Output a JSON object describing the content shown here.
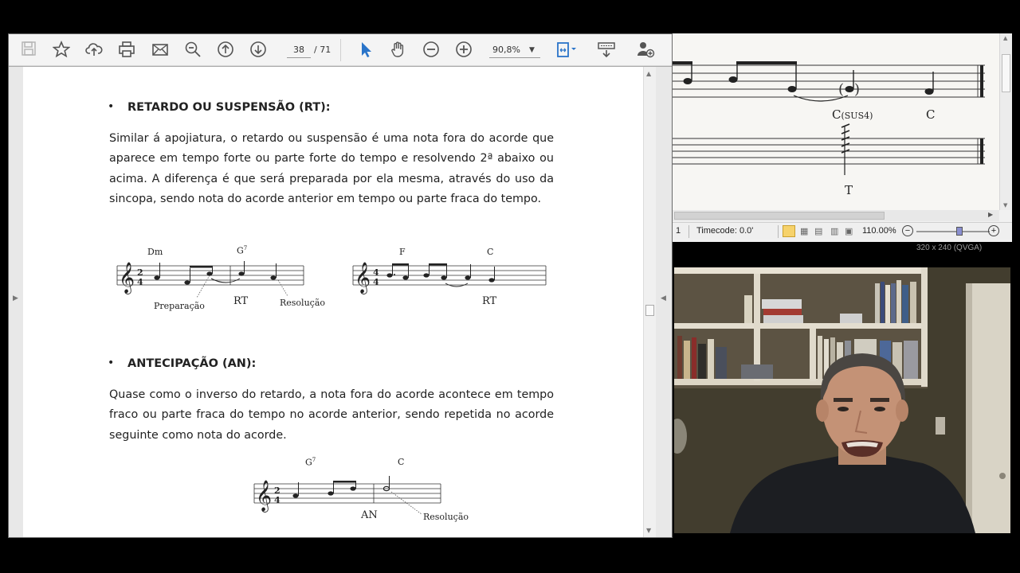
{
  "pdf_viewer": {
    "toolbar": {
      "page_current": "38",
      "page_total": "/ 71",
      "zoom_value": "90,8%",
      "icons": [
        "save-icon",
        "bookmark-star-icon",
        "cloud-upload-icon",
        "print-icon",
        "email-icon",
        "zoom-out-search-icon",
        "page-up-icon",
        "page-down-icon",
        "select-cursor-icon",
        "hand-tool-icon",
        "zoom-minus-icon",
        "zoom-plus-icon",
        "fit-page-icon",
        "read-mode-icon",
        "add-user-icon"
      ]
    },
    "document": {
      "section1": {
        "bullet": "•",
        "title": "RETARDO OU SUSPENSÃO (RT):",
        "paragraph": "Similar á apojiatura, o retardo ou suspensão é uma nota fora do acorde que aparece em tempo forte ou parte forte do tempo e resolvendo 2ª abaixo ou acima. A diferença é que será preparada por ela mesma, através do uso da sincopa, sendo nota do acorde anterior em tempo ou parte fraca do tempo.",
        "example1": {
          "chord1": "Dm",
          "chord2": "G",
          "chord2_sup": "7",
          "time_sig_top": "2",
          "time_sig_bottom": "4",
          "label_prep": "Preparação",
          "label_rt": "RT",
          "label_res": "Resolução"
        },
        "example2": {
          "chord1": "F",
          "chord2": "C",
          "time_sig_top": "4",
          "time_sig_bottom": "4",
          "label_rt": "RT"
        }
      },
      "section2": {
        "bullet": "•",
        "title": "ANTECIPAÇÃO (AN):",
        "paragraph": "Quase como o inverso do retardo, a nota fora do acorde acontece em tempo fraco ou parte fraca do tempo no acorde anterior, sendo repetida no acorde seguinte como nota do acorde.",
        "example": {
          "chord1": "G",
          "chord1_sup": "7",
          "chord2": "C",
          "time_sig_top": "2",
          "time_sig_bottom": "4",
          "label_an": "AN",
          "label_res": "Resolução"
        }
      }
    }
  },
  "notation_window": {
    "chord1": "C",
    "chord1_suffix": "(SUS4)",
    "chord2": "C",
    "tab_label": "T",
    "status": {
      "field1": "1",
      "timecode": "Timecode: 0.0'",
      "zoom": "110.00%"
    },
    "resolution_label": "320 x 240 (QVGA)"
  }
}
